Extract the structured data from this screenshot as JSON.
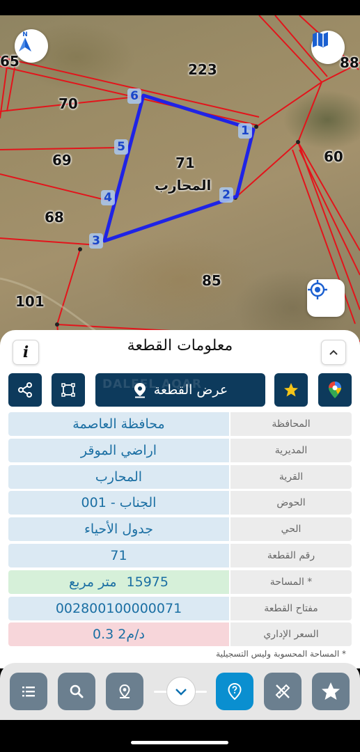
{
  "map": {
    "parcel_numbers": {
      "p65": "65",
      "p223": "223",
      "p88": "88",
      "p70": "70",
      "p60": "60",
      "p69": "69",
      "p71": "71",
      "p68": "68",
      "p85": "85",
      "p101": "101"
    },
    "selected_parcel_name": "المحارب",
    "vertex_labels": [
      "1",
      "2",
      "3",
      "4",
      "5",
      "6"
    ],
    "colors": {
      "parcel_boundary": "#e3141b",
      "selected_boundary": "#1f23e6"
    }
  },
  "sheet": {
    "title": "معلومات القطعة",
    "info_label": "i",
    "view_parcel_label": "عرض القطعة",
    "watermark": "DALEEL AQAR",
    "rows": [
      {
        "label": "المحافظة",
        "value": "محافظة العاصمة"
      },
      {
        "label": "المديرية",
        "value": "اراضي الموقر"
      },
      {
        "label": "القرية",
        "value": "المحارب"
      },
      {
        "label": "الحوض",
        "value": "الجناب - 001"
      },
      {
        "label": "الحي",
        "value": "جدول الأحياء"
      },
      {
        "label": "رقم القطعة",
        "value": "71"
      },
      {
        "label": "المساحة *",
        "value_number": "15975",
        "value_unit": "متر مربع"
      },
      {
        "label": "مفتاح القطعة",
        "value": "002800100000071"
      },
      {
        "label": "السعر الإداري",
        "value": "0.3 د/م2"
      }
    ],
    "footnote": "* المساحة المحسوبة وليس التسجيلية",
    "colors": {
      "primary": "#0d3a5c",
      "value_text": "#1b6fa3",
      "area_bg": "#d6f0d9",
      "price_bg": "#f7d6da",
      "value_bg": "#dbe9f3"
    }
  },
  "toolbar": {
    "icons": [
      "list-icon",
      "search-icon",
      "location-pin-icon",
      "chevron-down-icon",
      "help-pin-icon",
      "measure-icon",
      "star-icon"
    ],
    "colors": {
      "button": "#6b7f8f",
      "active": "#0a8fd0"
    }
  }
}
